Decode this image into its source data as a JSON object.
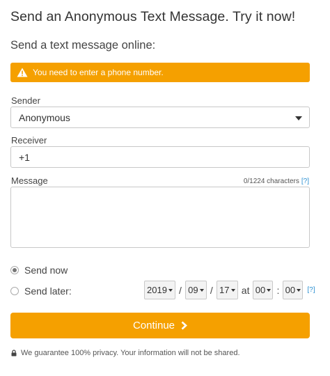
{
  "title": "Send an Anonymous Text Message. Try it now!",
  "subtitle": "Send a text message online:",
  "alert": {
    "text": "You need to enter a phone number.",
    "icon": "warning-icon"
  },
  "sender": {
    "label": "Sender",
    "value": "Anonymous"
  },
  "receiver": {
    "label": "Receiver",
    "value": "+1"
  },
  "message": {
    "label": "Message",
    "value": "",
    "counter": "0/1224 characters",
    "help": "[?]"
  },
  "schedule": {
    "send_now_label": "Send now",
    "send_later_label": "Send later:",
    "selected": "send_now",
    "year": "2019",
    "month": "09",
    "day": "17",
    "date_sep": "/",
    "at_label": "at",
    "hour": "00",
    "minute": "00",
    "time_sep": ":",
    "help": "[?]"
  },
  "continue_label": "Continue",
  "privacy_text": "We guarantee 100% privacy. Your information will not be shared.",
  "colors": {
    "accent": "#f5a000",
    "link": "#2a8fd1"
  }
}
